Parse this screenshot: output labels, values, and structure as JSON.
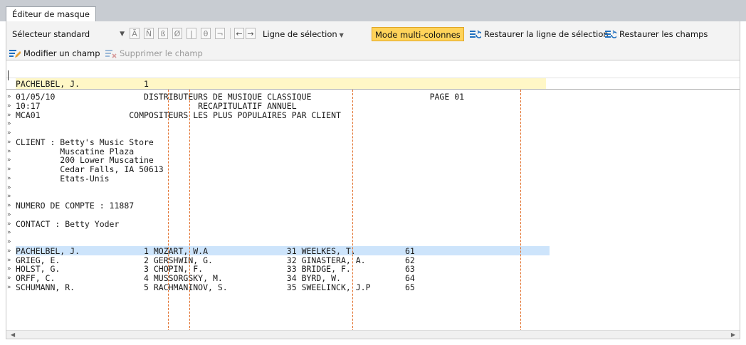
{
  "tab": {
    "label": "Éditeur de masque"
  },
  "toolbar": {
    "selector": "Sélecteur standard",
    "format_buttons": [
      "Ã",
      "Ñ",
      "ß",
      "Ø",
      "|",
      "θ",
      "¬"
    ],
    "arrow_left": "←",
    "arrow_right": "→",
    "selection_line": "Ligne de sélection",
    "multi_column": "Mode multi-colonnes",
    "restore_line": "Restaurer la ligne de sélection",
    "restore_fields": "Restaurer les champs",
    "modify_field": "Modifier un champ",
    "delete_field": "Supprimer le champ"
  },
  "editor": {
    "selection_line": "PACHELBEL, J.             1",
    "marker_glyph": "»",
    "lines": [
      "01/05/10                  DISTRIBUTEURS DE MUSIQUE CLASSIQUE                        PAGE 01",
      "10:17                                RECAPITULATIF ANNUEL",
      "MCA01                  COMPOSITEURS LES PLUS POPULAIRES PAR CLIENT",
      "",
      "",
      "CLIENT : Betty's Music Store",
      "         Muscatine Plaza",
      "         200 Lower Muscatine",
      "         Cedar Falls, IA 50613",
      "         Etats-Unis",
      "",
      "",
      "NUMERO DE COMPTE : 11887",
      "",
      "CONTACT : Betty Yoder",
      "",
      "",
      "PACHELBEL, J.             1 MOZART, W.A                31 WEELKES, T.          61",
      "GRIEG, E.                 2 GERSHWIN, G.               32 GINASTERA, A.        62",
      "HOLST, G.                 3 CHOPIN, F.                 33 BRIDGE, F.           63",
      "ORFF, C.                  4 MUSSORGSKY, M.             34 BYRD, W.             64",
      "SCHUMANN, R.              5 RACHMANINOV, S.            35 SWEELINCK, J.P       65"
    ],
    "highlighted_line_index": 17
  },
  "colors": {
    "multi_column_bg": "#ffd35a",
    "selection_line_bg": "#fff7c6",
    "highlight_row_bg": "#cde4fb",
    "column_marker": "#e2702c"
  }
}
